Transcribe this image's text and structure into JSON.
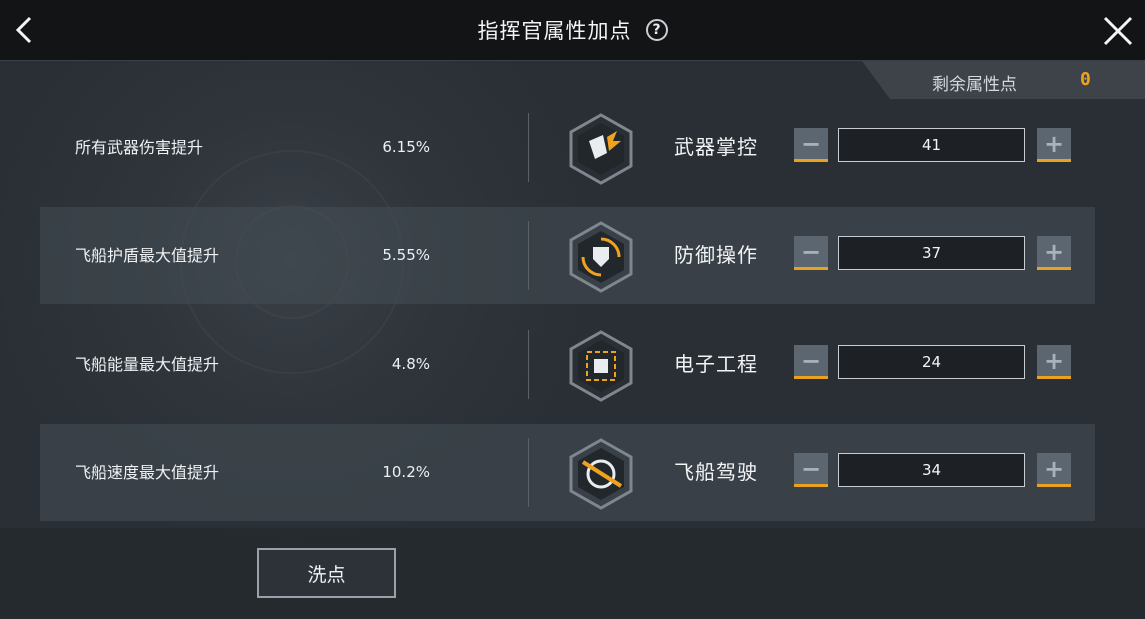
{
  "header": {
    "title": "指挥官属性加点",
    "help_symbol": "?",
    "back_icon": "chevron-left-icon",
    "close_icon": "close-icon"
  },
  "points": {
    "label": "剩余属性点",
    "value": "0"
  },
  "attributes": [
    {
      "bonus_label": "所有武器伤害提升",
      "bonus_value": "6.15%",
      "name": "武器掌控",
      "points": "41",
      "icon": "weapon-mastery-icon"
    },
    {
      "bonus_label": "飞船护盾最大值提升",
      "bonus_value": "5.55%",
      "name": "防御操作",
      "points": "37",
      "icon": "defense-shield-icon"
    },
    {
      "bonus_label": "飞船能量最大值提升",
      "bonus_value": "4.8%",
      "name": "电子工程",
      "points": "24",
      "icon": "electronics-chip-icon"
    },
    {
      "bonus_label": "飞船速度最大值提升",
      "bonus_value": "10.2%",
      "name": "飞船驾驶",
      "points": "34",
      "icon": "ship-piloting-icon"
    }
  ],
  "controls": {
    "minus_symbol": "−",
    "plus_symbol": "+"
  },
  "reset": {
    "label": "洗点"
  },
  "colors": {
    "accent": "#f0a21e",
    "header_bg": "#121416",
    "panel_bg": "#2b3036"
  }
}
